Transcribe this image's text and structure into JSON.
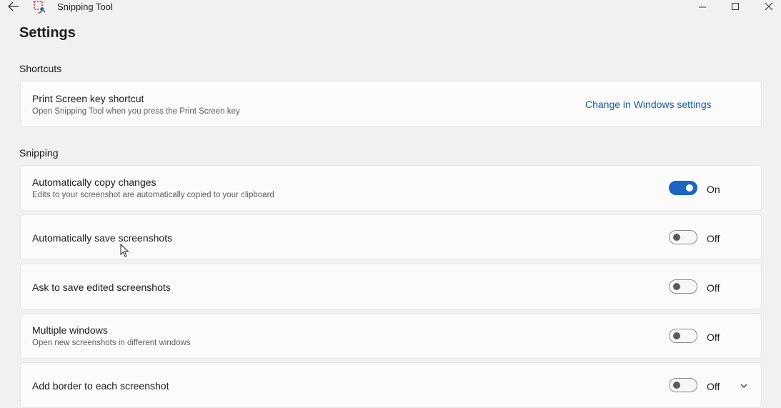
{
  "window": {
    "title": "Snipping Tool"
  },
  "page": {
    "title": "Settings"
  },
  "sections": {
    "shortcuts": {
      "label": "Shortcuts",
      "print_screen": {
        "title": "Print Screen key shortcut",
        "description": "Open Snipping Tool when you press the Print Screen key",
        "link": "Change in Windows settings"
      }
    },
    "snipping": {
      "label": "Snipping",
      "items": [
        {
          "title": "Automatically copy changes",
          "description": "Edits to your screenshot are automatically copied to your clipboard",
          "state": "On"
        },
        {
          "title": "Automatically save screenshots",
          "description": "",
          "state": "Off"
        },
        {
          "title": "Ask to save edited screenshots",
          "description": "",
          "state": "Off"
        },
        {
          "title": "Multiple windows",
          "description": "Open new screenshots in different windows",
          "state": "Off"
        },
        {
          "title": "Add border to each screenshot",
          "description": "",
          "state": "Off"
        }
      ]
    }
  },
  "icons": {
    "back": "back-arrow-icon",
    "app": "snipping-tool-icon",
    "minimize": "minimize-icon",
    "maximize": "maximize-icon",
    "close": "close-icon",
    "expand": "chevron-down-icon"
  },
  "colors": {
    "accent": "#1a66c2",
    "link": "#0f5fa8",
    "background": "#f1f1f1",
    "card": "#fbfbfb"
  }
}
